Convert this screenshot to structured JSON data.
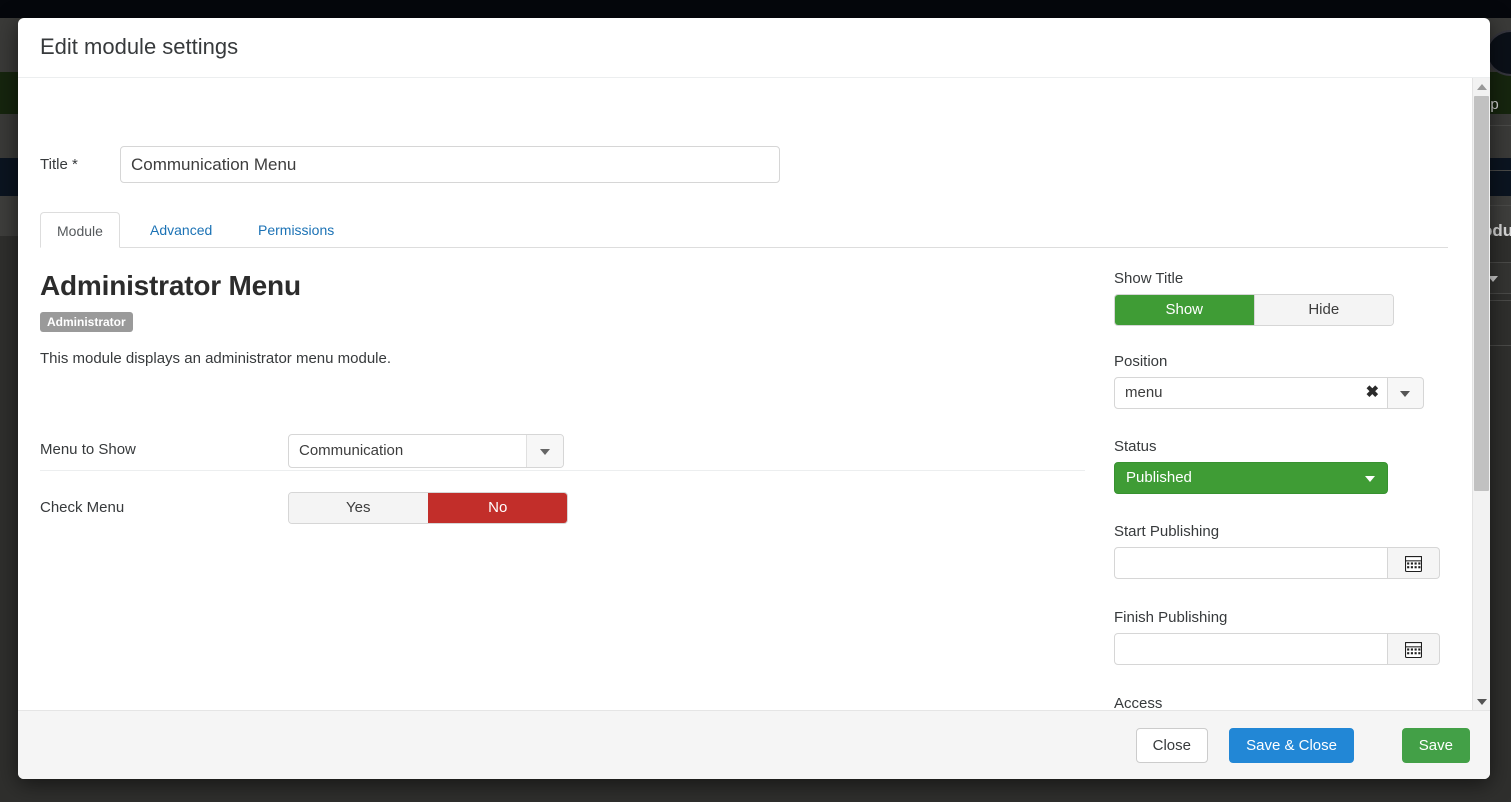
{
  "background": {
    "help_fragment": "lp",
    "module_fragment": "odu"
  },
  "modal": {
    "title": "Edit module settings"
  },
  "title_field": {
    "label": "Title *",
    "value": "Communication Menu",
    "placeholder": ""
  },
  "tabs": [
    {
      "label": "Module",
      "active": true
    },
    {
      "label": "Advanced",
      "active": false
    },
    {
      "label": "Permissions",
      "active": false
    }
  ],
  "module_info": {
    "heading": "Administrator Menu",
    "badge": "Administrator",
    "description": "This module displays an administrator menu module."
  },
  "left_fields": {
    "menu_to_show": {
      "label": "Menu to Show",
      "value": "Communication"
    },
    "check_menu": {
      "label": "Check Menu",
      "options": [
        "Yes",
        "No"
      ],
      "selected": "No"
    }
  },
  "right_fields": {
    "show_title": {
      "label": "Show Title",
      "options": [
        "Show",
        "Hide"
      ],
      "selected": "Show"
    },
    "position": {
      "label": "Position",
      "value": "menu",
      "clear_icon": "✖"
    },
    "status": {
      "label": "Status",
      "value": "Published"
    },
    "start_publishing": {
      "label": "Start Publishing",
      "value": "",
      "placeholder": ""
    },
    "finish_publishing": {
      "label": "Finish Publishing",
      "value": "",
      "placeholder": ""
    },
    "access": {
      "label": "Access"
    }
  },
  "footer": {
    "close_label": "Close",
    "save_close_label": "Save & Close",
    "save_label": "Save"
  },
  "colors": {
    "green": "#3f9c35",
    "red": "#c22e2a",
    "blue": "#2287d6",
    "save_green": "#43a047",
    "badge_gray": "#9a9a9a"
  }
}
